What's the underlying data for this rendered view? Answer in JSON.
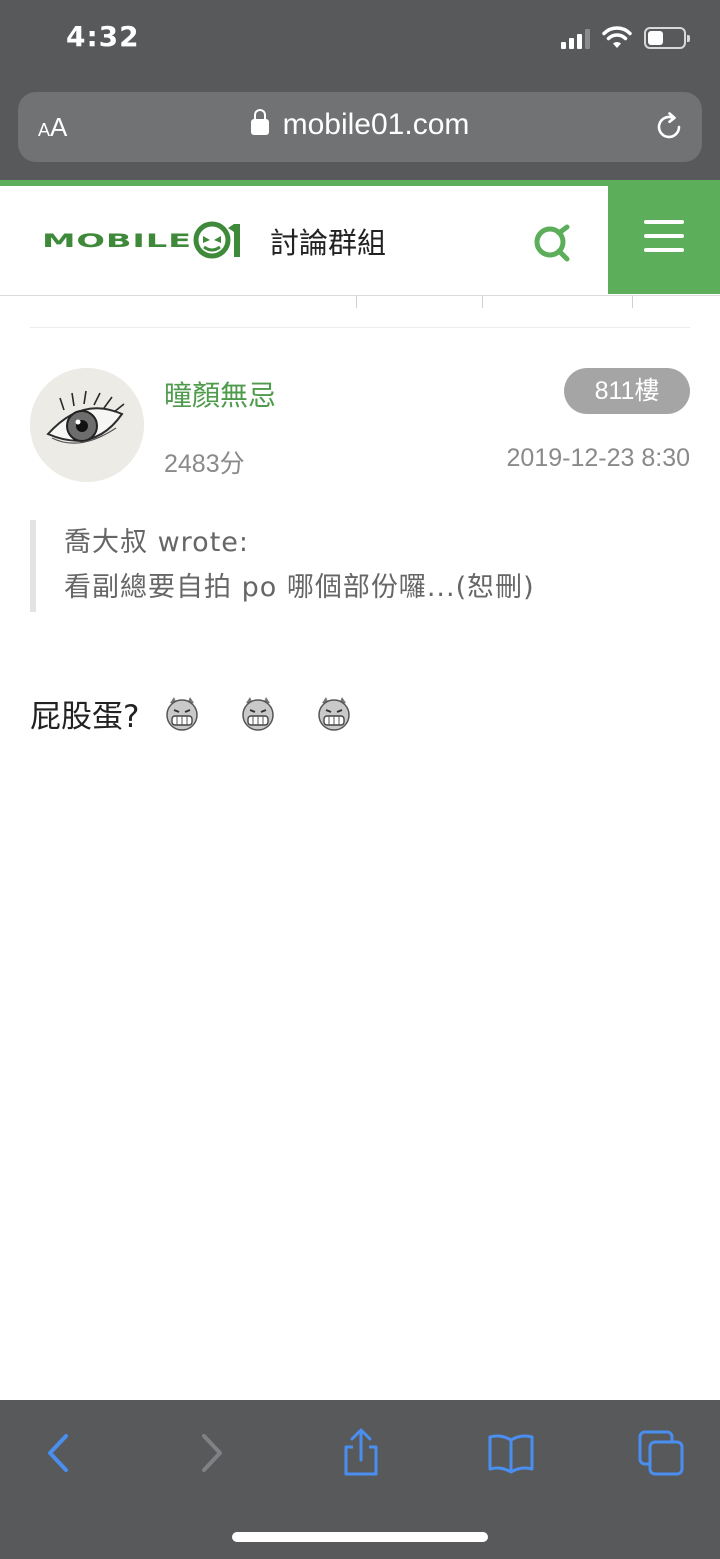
{
  "status_bar": {
    "time": "4:32"
  },
  "browser": {
    "aa_small": "A",
    "aa_big": "A",
    "url": "mobile01.com",
    "lock_icon": "lock-icon",
    "reload_icon": "reload-icon"
  },
  "site_header": {
    "logo_text": "MOBILE01",
    "section_title": "討論群組",
    "search_icon": "search-icon",
    "menu_icon": "hamburger-menu-icon",
    "brand_color": "#5cae5b"
  },
  "post": {
    "username": "曈顏無忌",
    "floor": "811樓",
    "score": "2483分",
    "timestamp": "2019-12-23 8:30",
    "quote": {
      "author_line": "喬大叔 wrote:",
      "text": "看副總要自拍 po 哪個部份囉...(恕刪)"
    },
    "body_text": "屁股蛋?",
    "emoticons": [
      "grin-emoticon",
      "grin-emoticon",
      "grin-emoticon"
    ]
  },
  "toolbar": {
    "back_icon": "back-chevron-icon",
    "forward_icon": "forward-chevron-icon",
    "share_icon": "share-icon",
    "bookmarks_icon": "bookmarks-book-icon",
    "tabs_icon": "tabs-icon",
    "accent_color": "#4a8ef0"
  }
}
